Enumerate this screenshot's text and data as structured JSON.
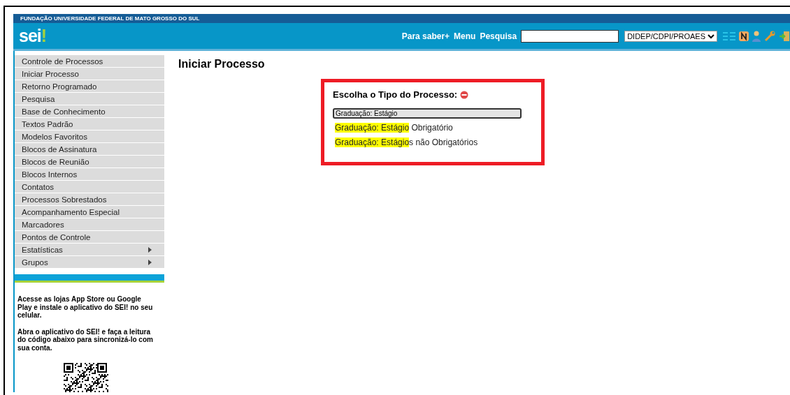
{
  "header": {
    "institution": "FUNDAÇÃO UNIVERSIDADE FEDERAL DE MATO GROSSO DO SUL",
    "logo": "sei",
    "logo_mark": "!",
    "links": [
      "Para saber+",
      "Menu",
      "Pesquisa"
    ],
    "unit_select": "DIDEP/CDPI/PROAES"
  },
  "sidebar": {
    "items": [
      {
        "label": "Controle de Processos",
        "submenu": false
      },
      {
        "label": "Iniciar Processo",
        "submenu": false
      },
      {
        "label": "Retorno Programado",
        "submenu": false
      },
      {
        "label": "Pesquisa",
        "submenu": false
      },
      {
        "label": "Base de Conhecimento",
        "submenu": false
      },
      {
        "label": "Textos Padrão",
        "submenu": false
      },
      {
        "label": "Modelos Favoritos",
        "submenu": false
      },
      {
        "label": "Blocos de Assinatura",
        "submenu": false
      },
      {
        "label": "Blocos de Reunião",
        "submenu": false
      },
      {
        "label": "Blocos Internos",
        "submenu": false
      },
      {
        "label": "Contatos",
        "submenu": false
      },
      {
        "label": "Processos Sobrestados",
        "submenu": false
      },
      {
        "label": "Acompanhamento Especial",
        "submenu": false
      },
      {
        "label": "Marcadores",
        "submenu": false
      },
      {
        "label": "Pontos de Controle",
        "submenu": false
      },
      {
        "label": "Estatísticas",
        "submenu": true
      },
      {
        "label": "Grupos",
        "submenu": true
      }
    ],
    "app_text": [
      "Acesse as lojas App Store ou Google Play e instale o aplicativo do SEI! no seu celular.",
      "Abra o aplicativo do SEI! e faça a leitura do código abaixo para sincronizá-lo com sua conta."
    ]
  },
  "page_title": "Iniciar Processo",
  "chooser": {
    "title": "Escolha o Tipo do Processo:",
    "value": "Graduação: Estágio",
    "options": [
      {
        "match": "Graduação: Estágio",
        "rest": " Obrigatório"
      },
      {
        "match": "Graduação: Estágio",
        "rest": "s não Obrigatórios"
      }
    ]
  }
}
